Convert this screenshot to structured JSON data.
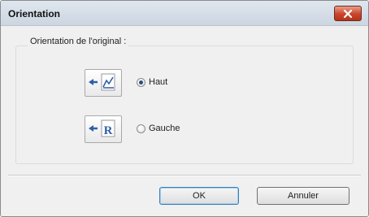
{
  "window": {
    "title": "Orientation"
  },
  "group": {
    "label": "Orientation de l'original :"
  },
  "options": [
    {
      "label": "Haut",
      "checked": true,
      "icon": "portrait-top-orientation-icon"
    },
    {
      "label": "Gauche",
      "checked": false,
      "icon": "landscape-left-orientation-icon"
    }
  ],
  "buttons": {
    "ok": "OK",
    "cancel": "Annuler"
  },
  "colors": {
    "close_button": "#c9452b",
    "accent_blue": "#2f5fa8",
    "titlebar": "#dfe6ee"
  }
}
